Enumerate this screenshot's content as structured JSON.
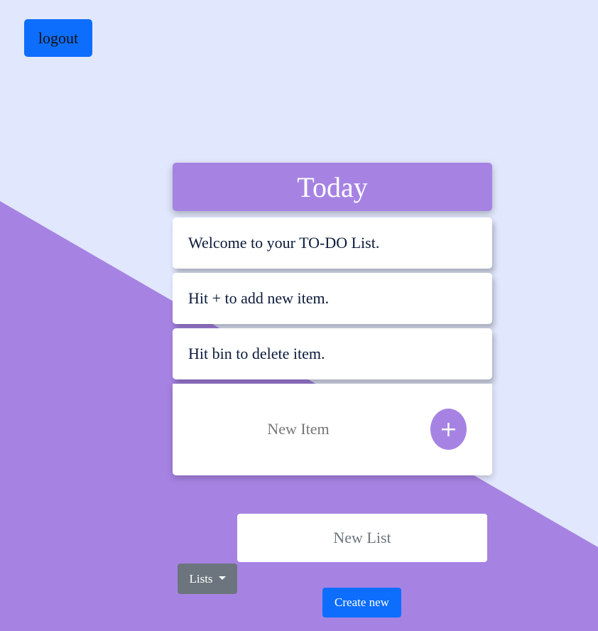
{
  "header": {
    "logout_label": "logout"
  },
  "list": {
    "title": "Today",
    "items": [
      {
        "text": "Welcome to your TO-DO List."
      },
      {
        "text": "Hit + to add new item."
      },
      {
        "text": "Hit bin to delete item."
      }
    ],
    "new_item": {
      "placeholder": "New Item",
      "value": ""
    },
    "add_button_label": "+"
  },
  "lists_panel": {
    "new_list_placeholder": "New List",
    "lists_dropdown_label": "Lists",
    "create_button_label": "Create new"
  },
  "colors": {
    "background": "#e1e7fc",
    "accent_purple": "#a683e3",
    "primary_blue": "#0d6efd",
    "secondary_gray": "#6c757d"
  }
}
